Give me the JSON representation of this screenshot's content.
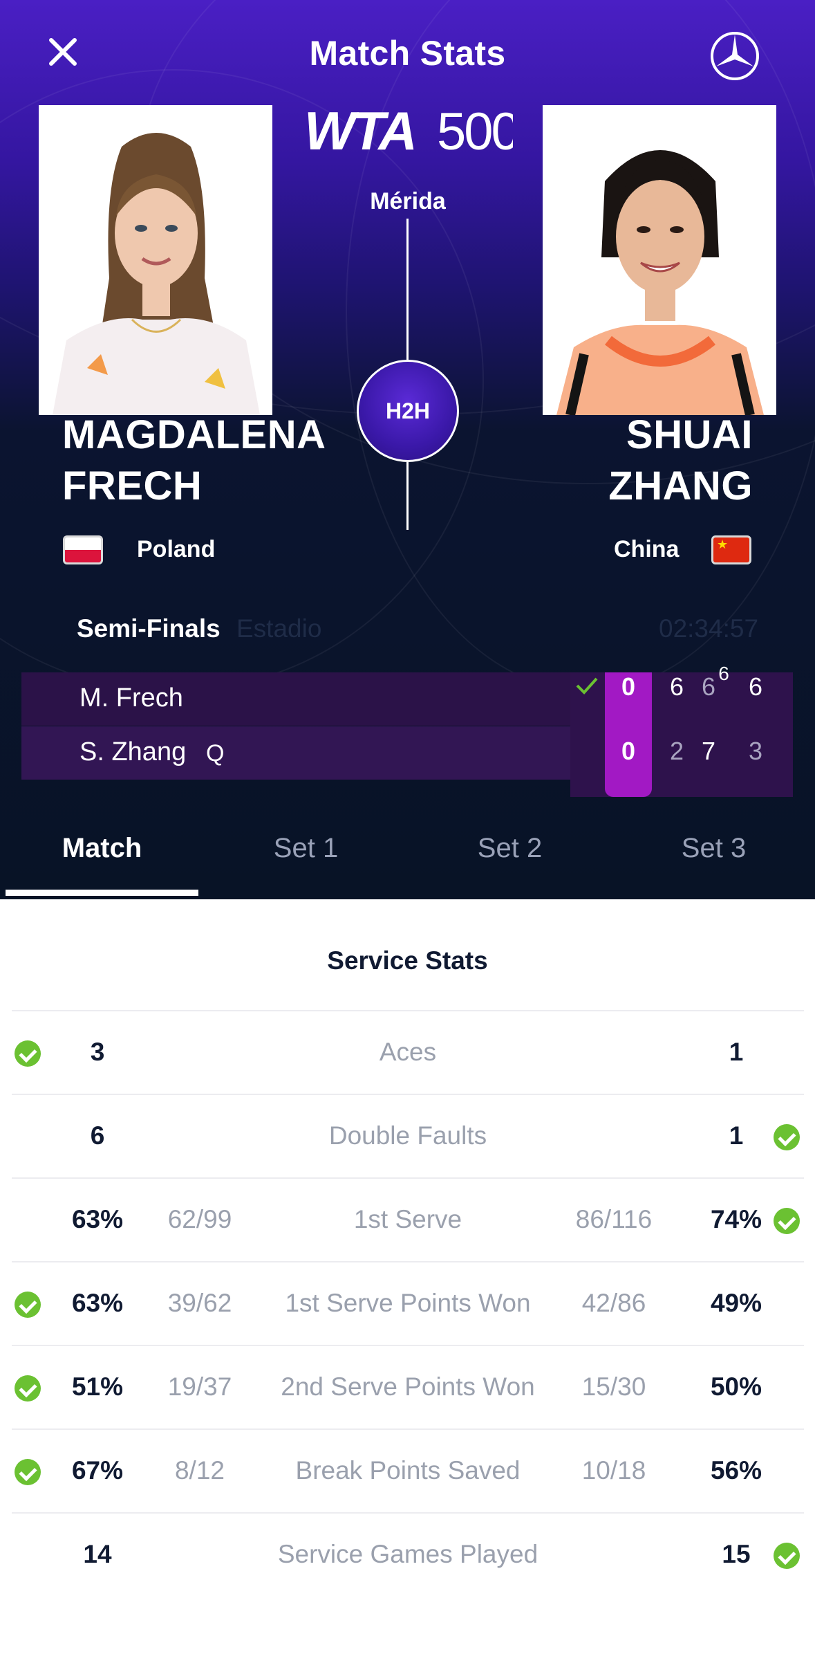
{
  "header": {
    "title": "Match Stats"
  },
  "tournament": {
    "logo_text": "WTA",
    "level": "500",
    "city": "Mérida"
  },
  "h2h_label": "H2H",
  "players": [
    {
      "first": "MAGDALENA",
      "last": "FRECH",
      "country": "Poland",
      "short": "M. Frech",
      "badge": "",
      "flag": "poland-flag"
    },
    {
      "first": "SHUAI",
      "last": "ZHANG",
      "country": "China",
      "short": "S. Zhang",
      "badge": "Q",
      "flag": "china-flag"
    }
  ],
  "match": {
    "round": "Semi-Finals",
    "court": "Estadio",
    "duration": "02:34:57"
  },
  "score": {
    "p1": {
      "current": "0",
      "sets": [
        "6",
        "6",
        "6"
      ],
      "tiebreak": "6"
    },
    "p2": {
      "current": "0",
      "sets": [
        "2",
        "7",
        "3"
      ]
    },
    "winner": "p1"
  },
  "tabs": [
    "Match",
    "Set 1",
    "Set 2",
    "Set 3"
  ],
  "active_tab": "Match",
  "stats": {
    "section": "Service Stats",
    "rows": [
      {
        "label": "Aces",
        "p1": "3",
        "p1_sub": "",
        "p2": "1",
        "p2_sub": "",
        "leader": "p1"
      },
      {
        "label": "Double Faults",
        "p1": "6",
        "p1_sub": "",
        "p2": "1",
        "p2_sub": "",
        "leader": "p2"
      },
      {
        "label": "1st Serve",
        "p1": "63%",
        "p1_sub": "62/99",
        "p2": "74%",
        "p2_sub": "86/116",
        "leader": "p2"
      },
      {
        "label": "1st Serve Points Won",
        "p1": "63%",
        "p1_sub": "39/62",
        "p2": "49%",
        "p2_sub": "42/86",
        "leader": "p1"
      },
      {
        "label": "2nd Serve Points Won",
        "p1": "51%",
        "p1_sub": "19/37",
        "p2": "50%",
        "p2_sub": "15/30",
        "leader": "p1"
      },
      {
        "label": "Break Points Saved",
        "p1": "67%",
        "p1_sub": "8/12",
        "p2": "56%",
        "p2_sub": "10/18",
        "leader": "p1"
      },
      {
        "label": "Service Games Played",
        "p1": "14",
        "p1_sub": "",
        "p2": "15",
        "p2_sub": "",
        "leader": "p2"
      }
    ]
  },
  "colors": {
    "accent": "#a219c4",
    "check": "#6bc132",
    "hero_top": "#4a1fc4",
    "hero_bottom": "#081326"
  }
}
